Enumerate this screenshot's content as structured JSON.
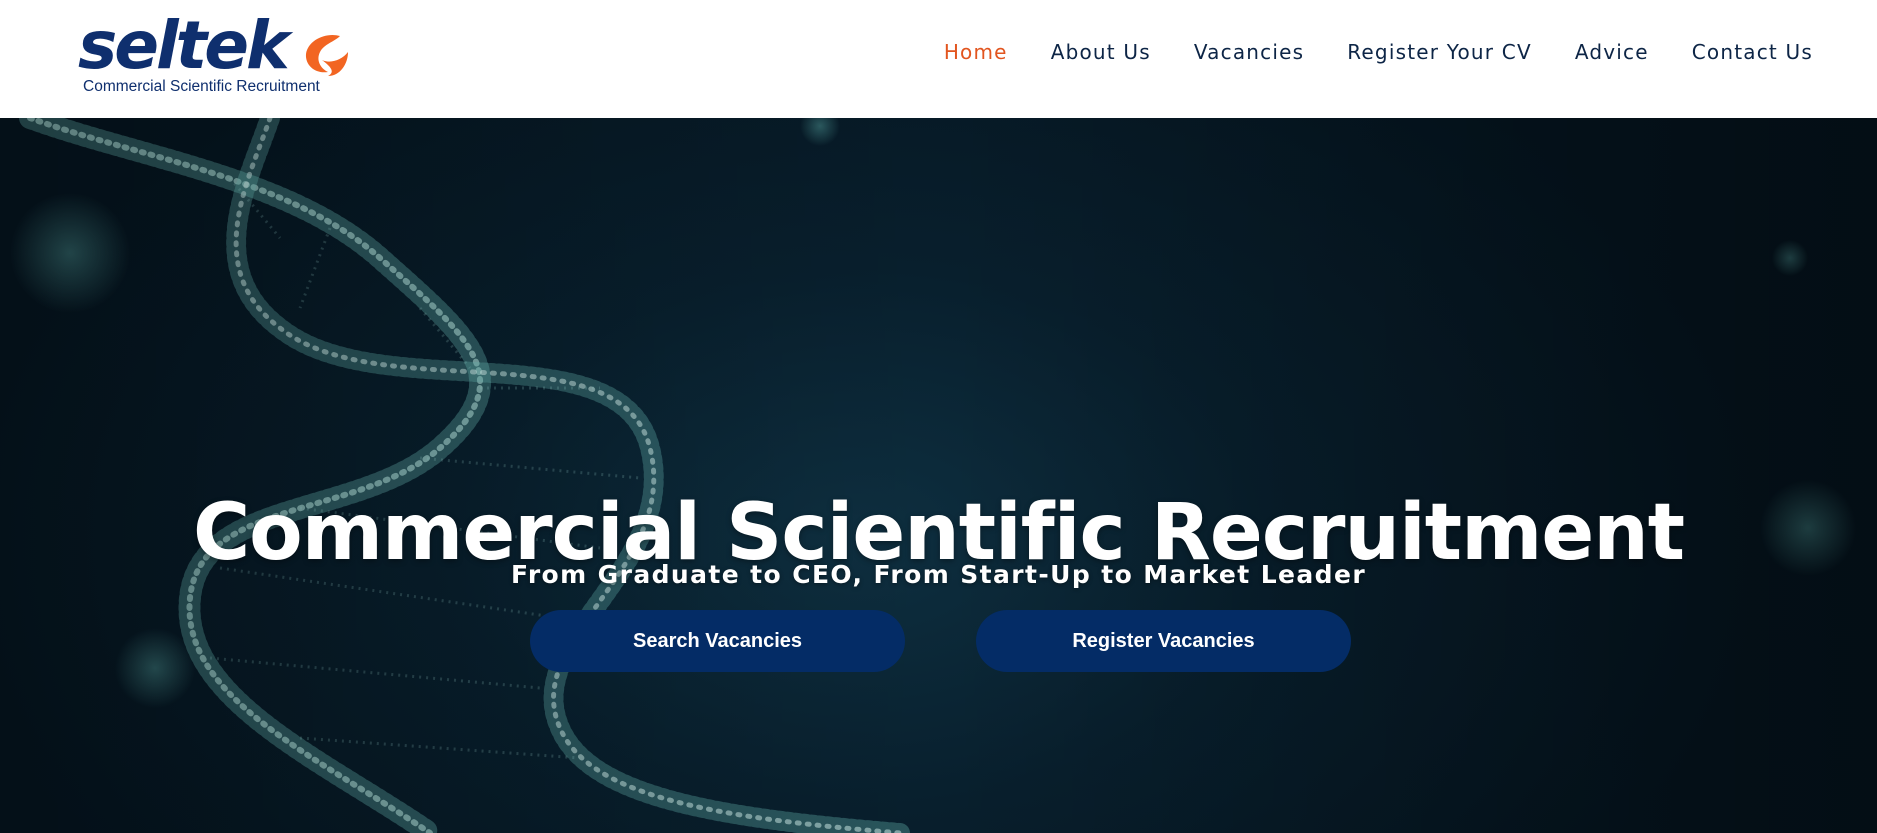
{
  "brand": {
    "name": "seltek",
    "tagline": "Commercial Scientific Recruitment",
    "primary_color": "#0f2f6e",
    "accent_color": "#f26522"
  },
  "nav": {
    "items": [
      {
        "label": "Home",
        "active": true
      },
      {
        "label": "About Us",
        "active": false
      },
      {
        "label": "Vacancies",
        "active": false
      },
      {
        "label": "Register Your CV",
        "active": false
      },
      {
        "label": "Advice",
        "active": false
      },
      {
        "label": "Contact Us",
        "active": false
      }
    ],
    "active_color": "#e2551f",
    "text_color": "#0d2546"
  },
  "hero": {
    "title": "Commercial Scientific Recruitment",
    "subtitle": "From Graduate to CEO, From Start-Up to Market Leader",
    "background_image": "dna-helix-particles",
    "buttons": {
      "search_label": "Search Vacancies",
      "register_label": "Register Vacancies"
    },
    "button_color": "#042c66"
  }
}
